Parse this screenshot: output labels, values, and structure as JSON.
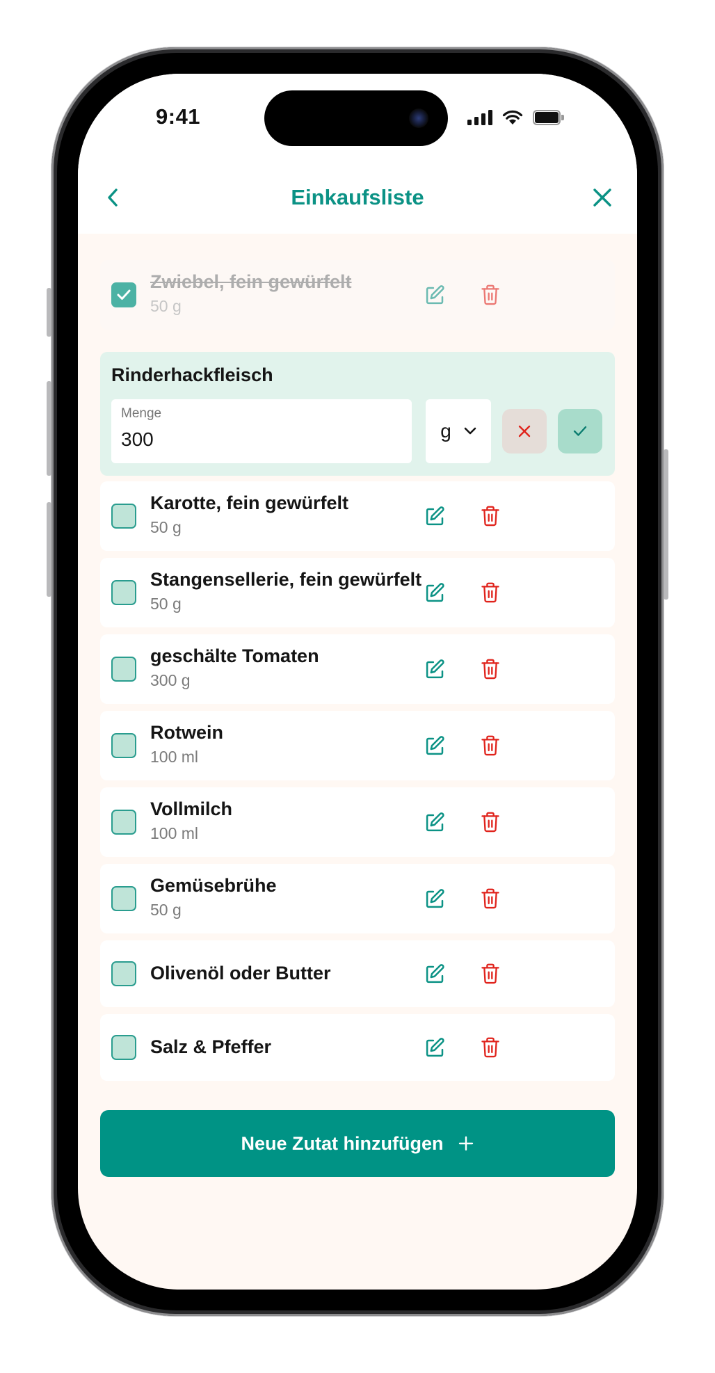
{
  "status_bar": {
    "time": "9:41"
  },
  "header": {
    "title": "Einkaufsliste"
  },
  "checked_items": [
    {
      "name": "Zwiebel, fein gewürfelt",
      "amount": "50 g"
    }
  ],
  "editing_item": {
    "name": "Rinderhackfleisch",
    "quantity_label": "Menge",
    "quantity_value": "300",
    "unit": "g"
  },
  "items": [
    {
      "name": "Karotte, fein gewürfelt",
      "amount": "50 g"
    },
    {
      "name": "Stangensellerie, fein gewürfelt",
      "amount": "50 g"
    },
    {
      "name": "geschälte Tomaten",
      "amount": "300 g"
    },
    {
      "name": "Rotwein",
      "amount": "100 ml"
    },
    {
      "name": "Vollmilch",
      "amount": "100 ml"
    },
    {
      "name": "Gemüsebrühe",
      "amount": "50 g"
    },
    {
      "name": "Olivenöl oder Butter"
    },
    {
      "name": "Salz & Pfeffer"
    }
  ],
  "add_button": {
    "label": "Neue Zutat hinzufügen"
  },
  "colors": {
    "accent": "#009385",
    "delete": "#e0231c",
    "checkbox_fill": "#bfe4d8",
    "edit_row_bg": "#e1f3ec",
    "screen_bg": "#fff8f3"
  },
  "icons": [
    "chevron-left-icon",
    "close-icon",
    "check-icon",
    "edit-icon",
    "trash-icon",
    "chevron-down-icon",
    "plus-icon"
  ]
}
